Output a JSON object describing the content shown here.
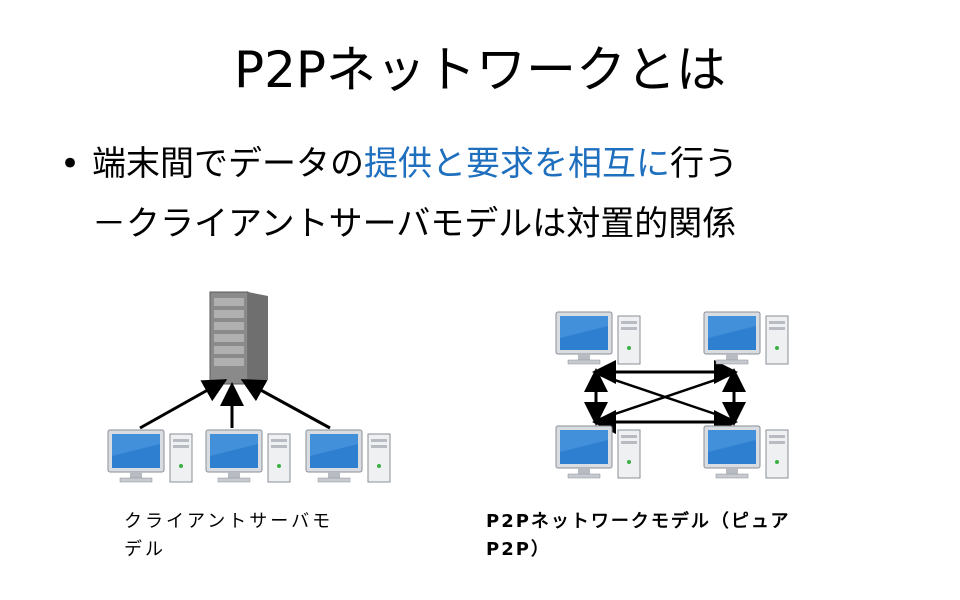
{
  "title": "P2Pネットワークとは",
  "bullet": {
    "marker": "•",
    "line1_pre": "端末間でデータの",
    "line1_hl": "提供と要求を相互に",
    "line1_post": "行う",
    "line2": "－クライアントサーバモデルは対置的関係"
  },
  "captions": {
    "client_server_line1": "クライアントサーバモ",
    "client_server_line2": "デル",
    "p2p_line1": "P2Pネットワークモデル（ピュア",
    "p2p_line2": "P2P）"
  },
  "colors": {
    "highlight": "#1f6fbf",
    "monitor_screen": "#2f7fd0",
    "server_body": "#8a8a8a"
  }
}
